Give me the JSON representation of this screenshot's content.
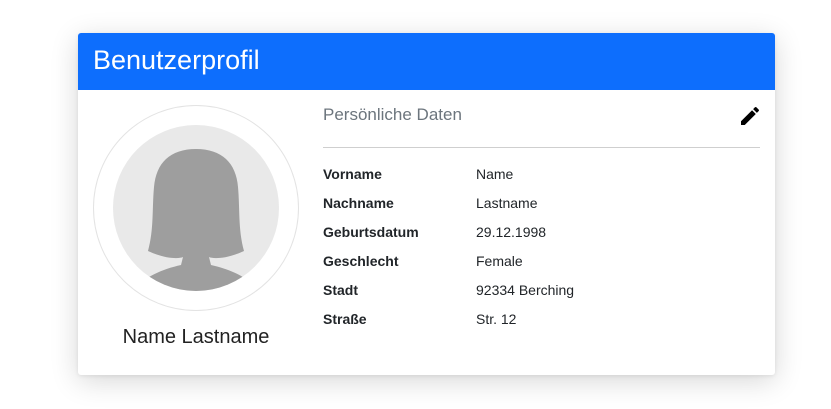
{
  "card": {
    "title": "Benutzerprofil",
    "header_color": "#0d6efd"
  },
  "profile": {
    "name": "Name Lastname",
    "avatar_icon": "female-silhouette-icon"
  },
  "details": {
    "section_title": "Persönliche Daten",
    "edit_icon": "pencil-icon",
    "rows": [
      {
        "label": "Vorname",
        "value": "Name"
      },
      {
        "label": "Nachname",
        "value": "Lastname"
      },
      {
        "label": "Geburtsdatum",
        "value": "29.12.1998"
      },
      {
        "label": "Geschlecht",
        "value": "Female"
      },
      {
        "label": "Stadt",
        "value": "92334 Berching"
      },
      {
        "label": "Straße",
        "value": "Str. 12"
      }
    ]
  }
}
